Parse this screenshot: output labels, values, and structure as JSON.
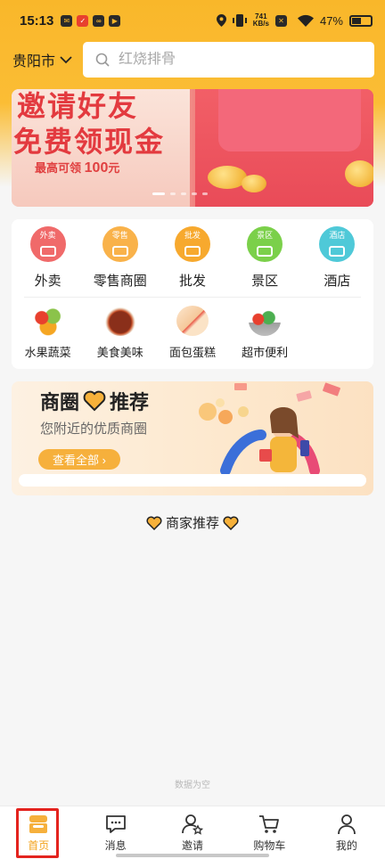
{
  "status_bar": {
    "time": "15:13",
    "net_speed_value": "741",
    "net_speed_unit": "KB/s",
    "battery": "47%"
  },
  "search": {
    "city": "贵阳市",
    "placeholder": "红烧排骨"
  },
  "banner": {
    "line1": "邀请好友",
    "line2": "免费领现金",
    "sub_prefix": "最高可领",
    "sub_amount": "100",
    "sub_suffix": "元",
    "slide_count": 5,
    "active_slide": 1
  },
  "categories_top": [
    {
      "label": "外卖",
      "badge": "外卖",
      "color": "#f06a6a",
      "icon": "scooter-icon"
    },
    {
      "label": "零售商圈",
      "badge": "零售",
      "color": "#f9b24a",
      "icon": "basket-icon"
    },
    {
      "label": "批发",
      "badge": "批发",
      "color": "#f7a92e",
      "icon": "box-icon"
    },
    {
      "label": "景区",
      "badge": "景区",
      "color": "#7bd04a",
      "icon": "scenic-icon"
    },
    {
      "label": "酒店",
      "badge": "酒店",
      "color": "#4fc9d8",
      "icon": "hotel-icon"
    }
  ],
  "categories_bottom": [
    {
      "label": "水果蔬菜",
      "icon": "fruit-veg-icon"
    },
    {
      "label": "美食美味",
      "icon": "food-icon"
    },
    {
      "label": "面包蛋糕",
      "icon": "bread-cake-icon"
    },
    {
      "label": "超市便利",
      "icon": "supermarket-icon"
    }
  ],
  "promo": {
    "title_left": "商圈",
    "title_right": "推荐",
    "subtitle": "您附近的优质商圈",
    "button": "查看全部 ›"
  },
  "section": {
    "title": "商家推荐"
  },
  "empty_text": "数据为空",
  "tabbar": [
    {
      "label": "首页",
      "icon": "home-shop-icon",
      "active": true
    },
    {
      "label": "消息",
      "icon": "message-icon",
      "active": false
    },
    {
      "label": "邀请",
      "icon": "invite-user-icon",
      "active": false
    },
    {
      "label": "购物车",
      "icon": "cart-icon",
      "active": false
    },
    {
      "label": "我的",
      "icon": "profile-icon",
      "active": false
    }
  ],
  "colors": {
    "accent": "#f9b72a",
    "active_tab": "#f3a21c",
    "highlight_frame": "#e3231e"
  }
}
